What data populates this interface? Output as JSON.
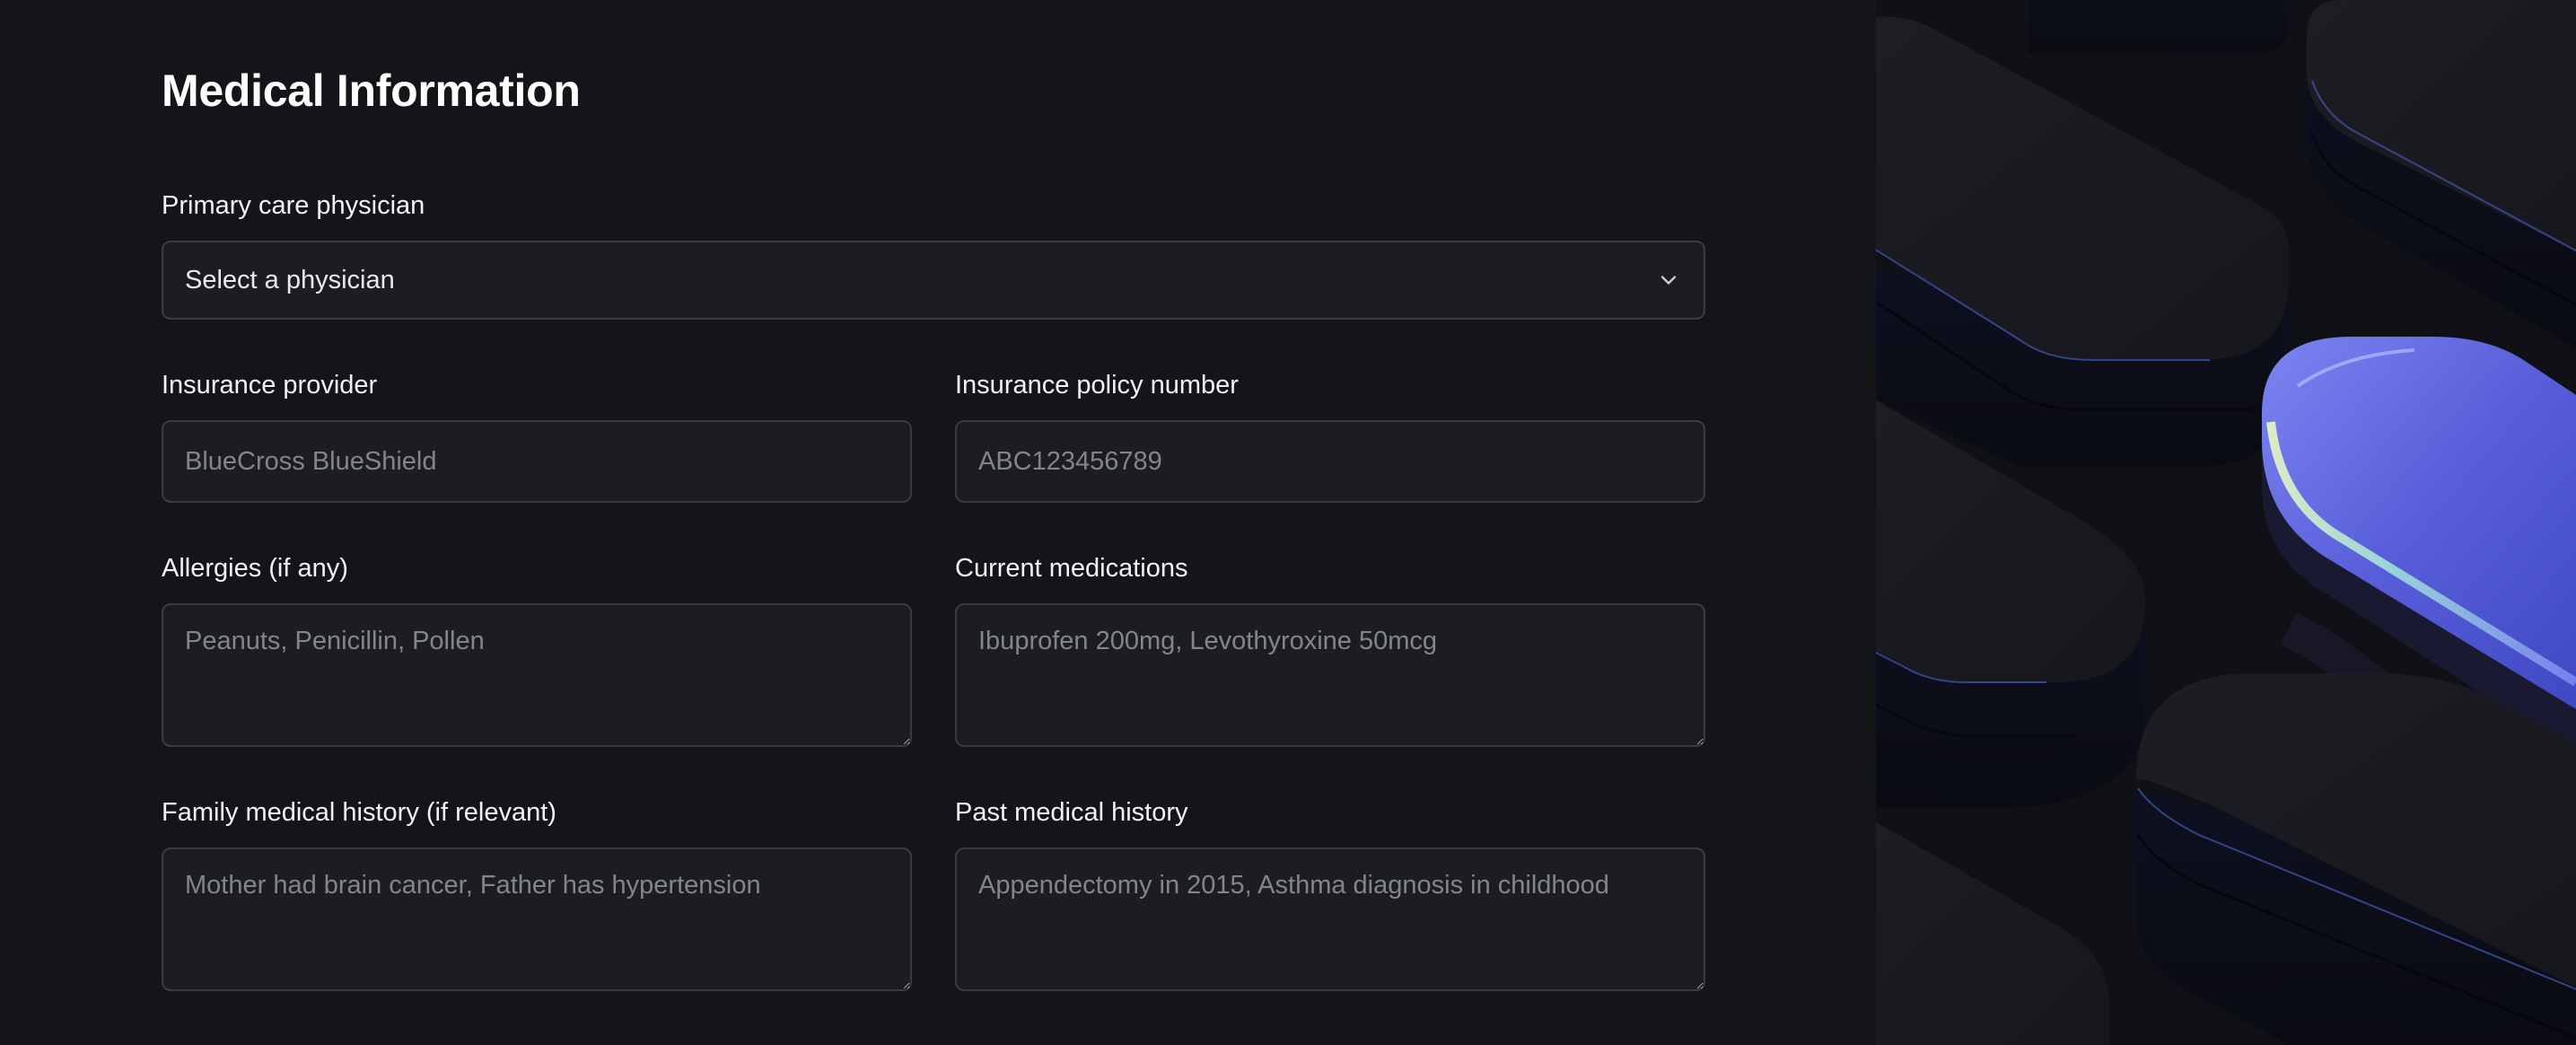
{
  "page": {
    "title": "Medical Information"
  },
  "form": {
    "physician": {
      "label": "Primary care physician",
      "value": "Select a physician"
    },
    "insurance_provider": {
      "label": "Insurance provider",
      "placeholder": "BlueCross BlueShield"
    },
    "insurance_policy": {
      "label": "Insurance policy number",
      "placeholder": "ABC123456789"
    },
    "allergies": {
      "label": "Allergies (if any)",
      "placeholder": "Peanuts, Penicillin, Pollen"
    },
    "medications": {
      "label": "Current medications",
      "placeholder": "Ibuprofen 200mg, Levothyroxine 50mcg"
    },
    "family_history": {
      "label": "Family medical history (if relevant)",
      "placeholder": "Mother had brain cancer, Father has hypertension"
    },
    "past_history": {
      "label": "Past medical history",
      "placeholder": "Appendectomy in 2015, Asthma diagnosis in childhood"
    }
  },
  "icons": {
    "select_chevron": "chevron-down-icon"
  },
  "colors": {
    "background": "#141519",
    "field_background": "#1c1d22",
    "field_border": "#393b42",
    "accent_pill": "#5a5fd6"
  }
}
